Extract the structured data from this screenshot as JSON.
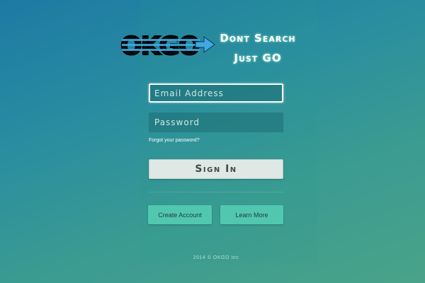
{
  "logo": {
    "text": "OKGO",
    "icon": "arrow-right-icon"
  },
  "tagline": {
    "line1": "Dont Search",
    "line2": "Just GO"
  },
  "form": {
    "email_placeholder": "Email Address",
    "password_placeholder": "Password",
    "forgot_label": "Forgot your password?",
    "signin_label": "Sign In"
  },
  "actions": {
    "create_label": "Create Account",
    "learn_label": "Learn More"
  },
  "footer": {
    "text": "2014 © OKGO Inc"
  },
  "colors": {
    "accent": "#52c7b0",
    "signin_bg": "#dfe8e5",
    "logo_blue": "#3fa8e0"
  }
}
